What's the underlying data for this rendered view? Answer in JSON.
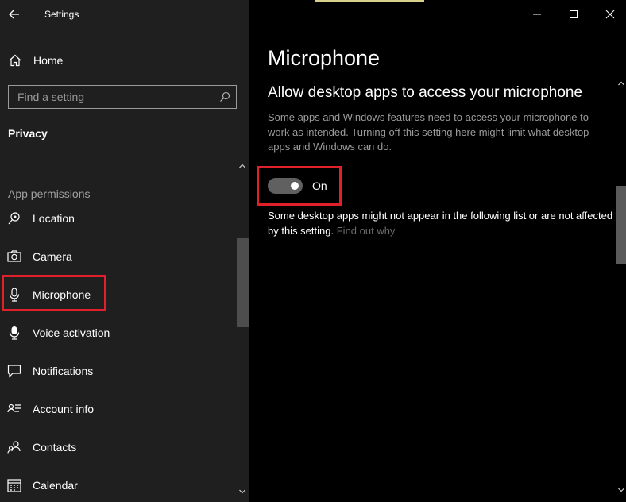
{
  "window": {
    "app_title": "Settings",
    "accent_color": "#d6d08a",
    "highlight_color": "#e0202a"
  },
  "sidebar": {
    "home_label": "Home",
    "search_placeholder": "Find a setting",
    "section_title": "Privacy",
    "group_title": "App permissions",
    "items": [
      {
        "label": "Location",
        "icon": "location-icon"
      },
      {
        "label": "Camera",
        "icon": "camera-icon"
      },
      {
        "label": "Microphone",
        "icon": "microphone-icon",
        "selected": true
      },
      {
        "label": "Voice activation",
        "icon": "voice-activation-icon"
      },
      {
        "label": "Notifications",
        "icon": "notifications-icon"
      },
      {
        "label": "Account info",
        "icon": "account-info-icon"
      },
      {
        "label": "Contacts",
        "icon": "contacts-icon"
      },
      {
        "label": "Calendar",
        "icon": "calendar-icon"
      }
    ]
  },
  "main": {
    "page_title": "Microphone",
    "setting_heading": "Allow desktop apps to access your microphone",
    "description": "Some apps and Windows features need to access your microphone to work as intended. Turning off this setting here might limit what desktop apps and Windows can do.",
    "toggle": {
      "state": "on",
      "label": "On"
    },
    "note_text": "Some desktop apps might not appear in the following list or are not affected by this setting.",
    "note_link": "Find out why"
  }
}
